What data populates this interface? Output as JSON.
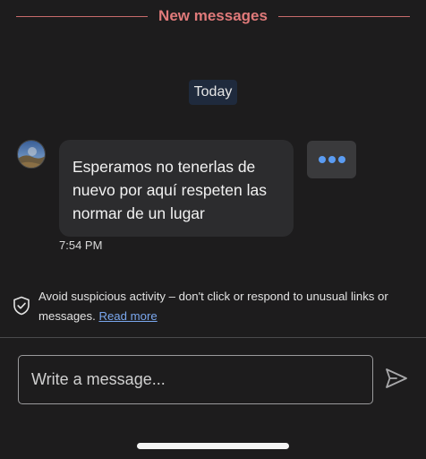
{
  "divider": {
    "label": "New messages"
  },
  "date_pill": {
    "label": "Today"
  },
  "message": {
    "text": "Esperamos no tenerlas de nuevo por aquí respeten las normar de un lugar",
    "time": "7:54 PM"
  },
  "warning": {
    "text": "Avoid suspicious activity – don't click or respond to unusual links or messages.",
    "link": "Read more"
  },
  "composer": {
    "placeholder": "Write a message..."
  },
  "icons": {
    "avatar": "avatar",
    "more": "more-dots-icon",
    "shield": "shield-check-icon",
    "send": "send-icon"
  },
  "colors": {
    "background": "#1d1c1d",
    "new_messages": "#e07a7a",
    "accent_blue": "#5b9cf2",
    "link": "#7aa7ee"
  }
}
